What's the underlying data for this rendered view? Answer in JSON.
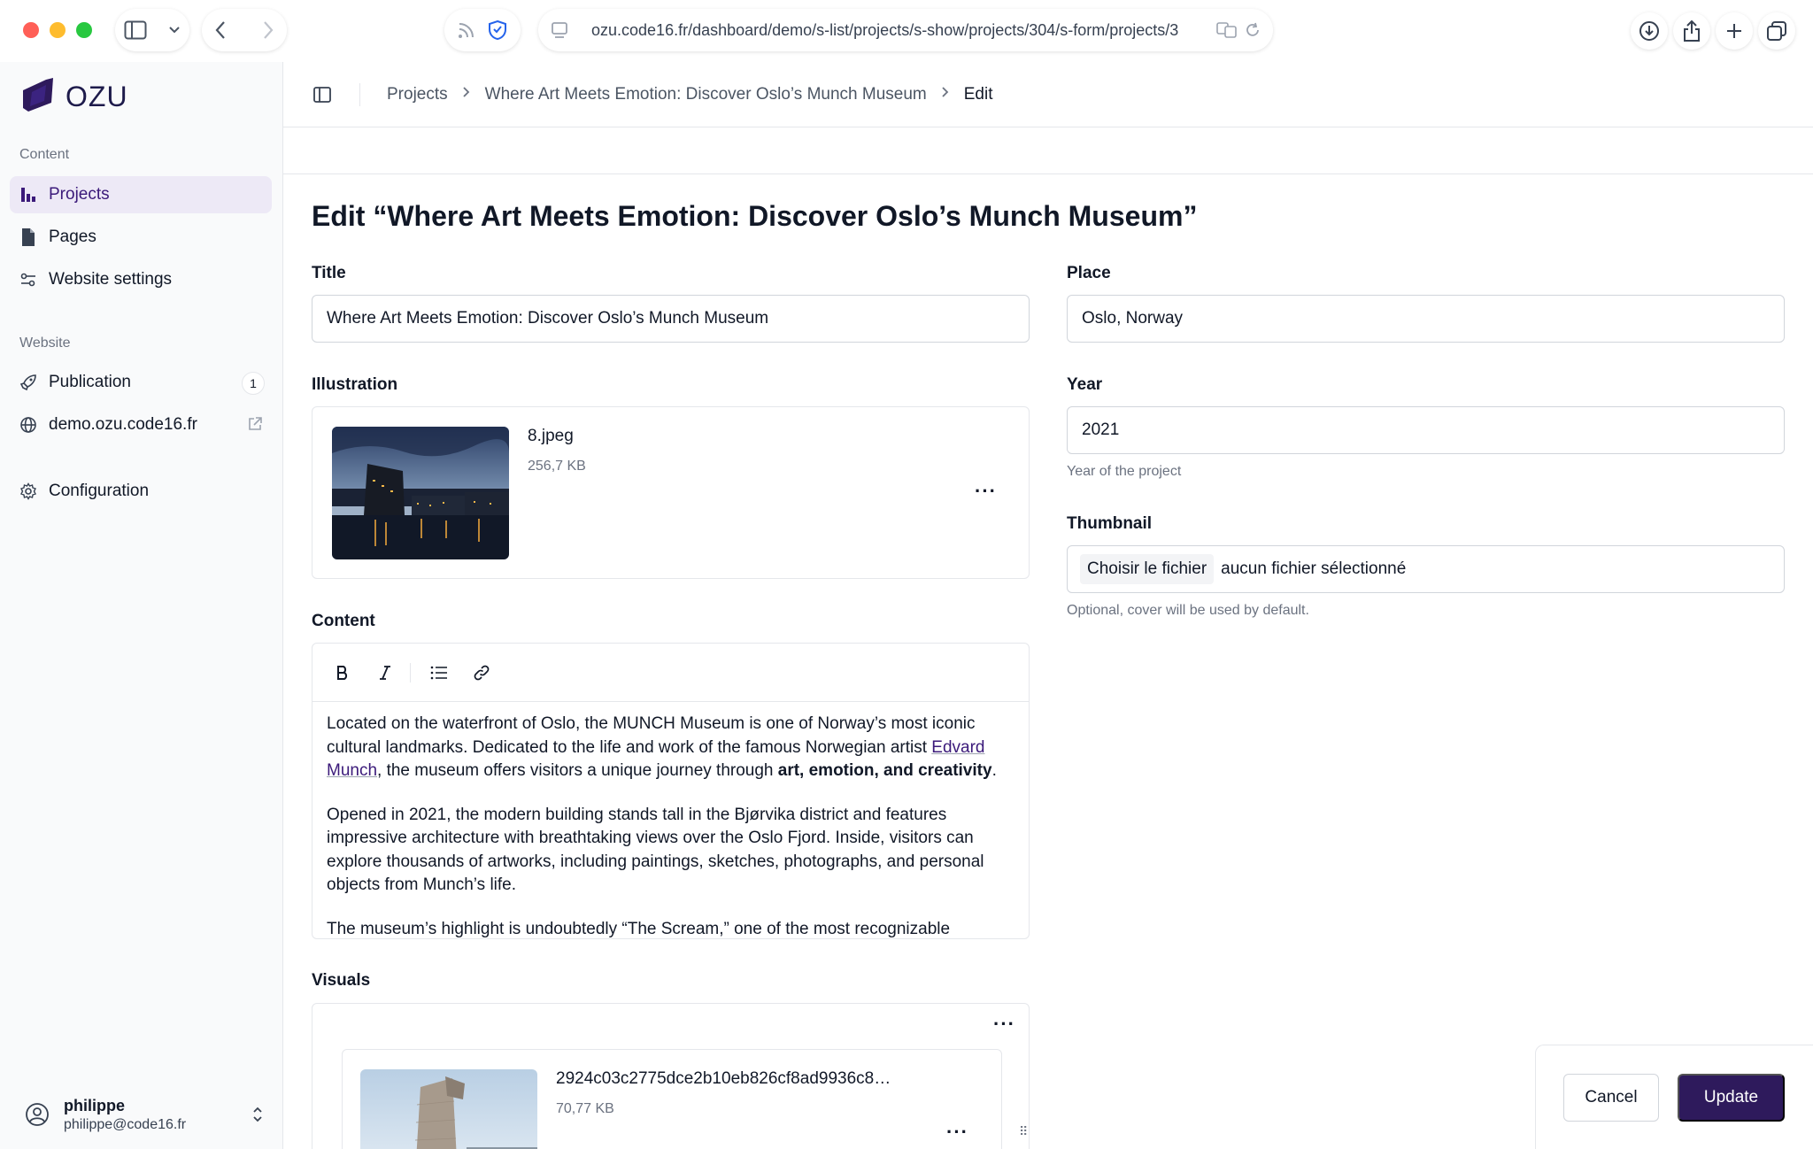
{
  "browser": {
    "url": "ozu.code16.fr/dashboard/demo/s-list/projects/s-show/projects/304/s-form/projects/3"
  },
  "sidebar": {
    "logo_text": "OZU",
    "content_section": "Content",
    "content_items": [
      {
        "label": "Projects",
        "icon": "projects-icon",
        "active": true
      },
      {
        "label": "Pages",
        "icon": "page-icon"
      },
      {
        "label": "Website settings",
        "icon": "settings-sliders-icon"
      }
    ],
    "website_section": "Website",
    "publication": {
      "label": "Publication",
      "badge": "1"
    },
    "site_link": {
      "label": "demo.ozu.code16.fr"
    },
    "configuration": {
      "label": "Configuration"
    },
    "user": {
      "name": "philippe",
      "email": "philippe@code16.fr"
    }
  },
  "breadcrumb": {
    "items": [
      "Projects",
      "Where Art Meets Emotion: Discover Oslo’s Munch Museum",
      "Edit"
    ]
  },
  "form": {
    "page_title": "Edit “Where Art Meets Emotion: Discover Oslo’s Munch Museum”",
    "title": {
      "label": "Title",
      "value": "Where Art Meets Emotion: Discover Oslo’s Munch Museum"
    },
    "place": {
      "label": "Place",
      "value": "Oslo, Norway"
    },
    "illustration": {
      "label": "Illustration",
      "file_name": "8.jpeg",
      "file_size": "256,7 KB"
    },
    "year": {
      "label": "Year",
      "value": "2021",
      "help": "Year of the project"
    },
    "thumbnail": {
      "label": "Thumbnail",
      "button": "Choisir le fichier",
      "status": "aucun fichier sélectionné",
      "help": "Optional, cover will be used by default."
    },
    "content": {
      "label": "Content",
      "p1_a": "Located on the waterfront of Oslo, the MUNCH Museum is one of Norway’s most iconic cultural landmarks. Dedicated to the life and work of the famous Norwegian artist ",
      "p1_link": "Edvard Munch",
      "p1_b": ", the museum offers visitors a unique journey through ",
      "p1_bold": "art, emotion, and creativity",
      "p1_c": ".",
      "p2": "Opened in 2021, the modern building stands tall in the Bjørvika district and features impressive architecture with breathtaking views over the Oslo Fjord. Inside, visitors can explore thousands of artworks, including paintings, sketches, photographs, and personal objects from Munch’s life.",
      "p3": "The museum’s highlight is undoubtedly “The Scream,” one of the most recognizable"
    },
    "visuals": {
      "label": "Visuals",
      "file_name": "2924c03c2775dce2b10eb826cf8ad9936c8…",
      "file_size": "70,77 KB"
    },
    "cancel_label": "Cancel",
    "update_label": "Update"
  }
}
